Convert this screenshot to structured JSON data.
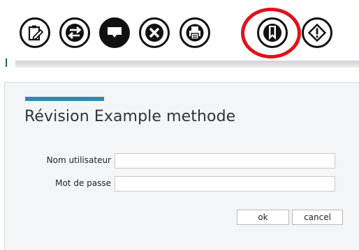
{
  "toolbar": {
    "buttons": [
      {
        "icon": "clipboard-edit-icon",
        "name": "edit-clipboard-button"
      },
      {
        "icon": "swap-arrows-icon",
        "name": "swap-button"
      },
      {
        "icon": "comment-icon",
        "name": "comment-button"
      },
      {
        "icon": "close-icon",
        "name": "close-button"
      },
      {
        "icon": "printer-icon",
        "name": "print-button"
      },
      {
        "icon": "bookmark-icon",
        "name": "bookmark-button"
      },
      {
        "icon": "warning-icon",
        "name": "warning-button"
      }
    ],
    "highlight_color": "#e1111c"
  },
  "dialog": {
    "title": "Révision Example methode",
    "accent_color": "#2e8ab2",
    "fields": {
      "username": {
        "label": "Nom utilisateur",
        "value": ""
      },
      "password": {
        "label": "Mot de passe",
        "value": ""
      }
    },
    "ok_label": "ok",
    "cancel_label": "cancel"
  }
}
